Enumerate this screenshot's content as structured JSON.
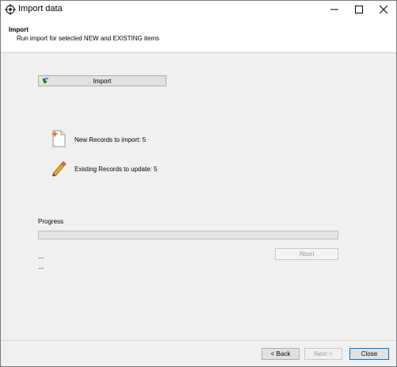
{
  "window": {
    "title": "Import data"
  },
  "header": {
    "title": "Import",
    "subtitle": "Run import for selected NEW and EXISTING items"
  },
  "import_button": {
    "label": "Import"
  },
  "records": {
    "new_label": "New Records to import: 5",
    "existing_label": "Existing Records to update: 5"
  },
  "progress": {
    "label": "Progress",
    "value": 0
  },
  "abort_button": {
    "label": "Abort"
  },
  "status_lines": [
    "...",
    "..."
  ],
  "footer": {
    "back_label": "< Back",
    "next_label": "Next >",
    "close_label": "Close"
  }
}
